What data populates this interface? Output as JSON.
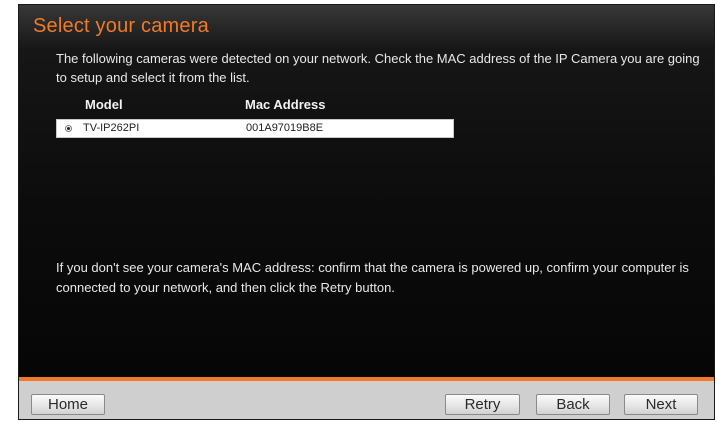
{
  "page": {
    "title": "Select your camera",
    "intro": "The following cameras were detected on your network. Check the MAC address of the IP Camera you are going to setup and select it from the list.",
    "help": "If you don't see your camera's MAC address: confirm that the camera is powered up, confirm your computer is connected to your network, and then click the Retry button."
  },
  "table": {
    "columns": [
      "Model",
      "Mac Address"
    ],
    "rows": [
      {
        "model": "TV-IP262PI",
        "mac": "001A97019B8E",
        "selected": true
      }
    ]
  },
  "buttons": {
    "home": "Home",
    "retry": "Retry",
    "back": "Back",
    "next": "Next"
  },
  "colors": {
    "accent": "#f07a28",
    "background": "#0c0c0c",
    "button_bar": "#cfcfcf"
  }
}
